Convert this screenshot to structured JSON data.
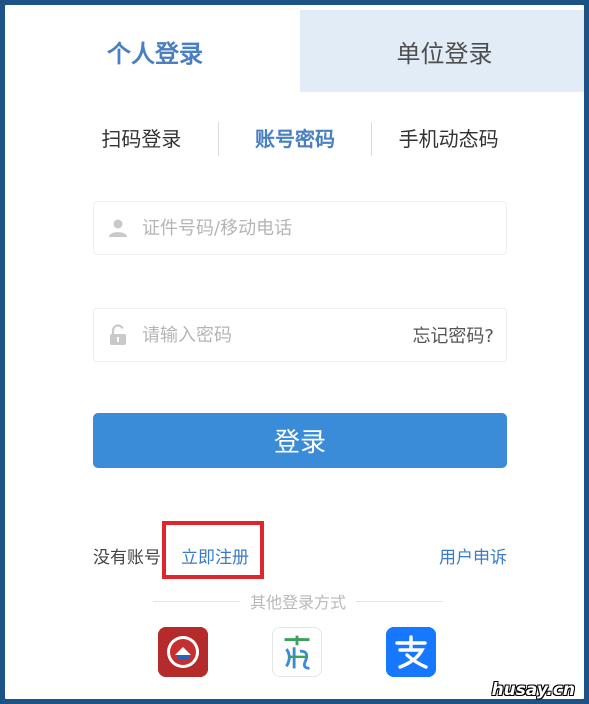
{
  "tabs": [
    {
      "label": "个人登录",
      "active": true
    },
    {
      "label": "单位登录",
      "active": false
    }
  ],
  "subtabs": [
    {
      "label": "扫码登录",
      "active": false
    },
    {
      "label": "账号密码",
      "active": true
    },
    {
      "label": "手机动态码",
      "active": false
    }
  ],
  "form": {
    "id_placeholder": "证件号码/移动电话",
    "password_placeholder": "请输入密码",
    "forgot_label": "忘记密码?",
    "login_label": "登录"
  },
  "register": {
    "no_account_label": "没有账号",
    "register_label": "立即注册",
    "appeal_label": "用户申诉"
  },
  "other_login": {
    "label": "其他登录方式",
    "apps": [
      {
        "icon": "government-app-icon"
      },
      {
        "icon": "su-app-icon"
      },
      {
        "icon": "alipay-icon"
      }
    ]
  },
  "watermark": "husay.cn",
  "colors": {
    "accent": "#4a7fc1",
    "button": "#3a8bd8",
    "highlight_box": "#e0262b",
    "inactive_tab": "#e2ecf7",
    "frame": "#1d5286"
  }
}
